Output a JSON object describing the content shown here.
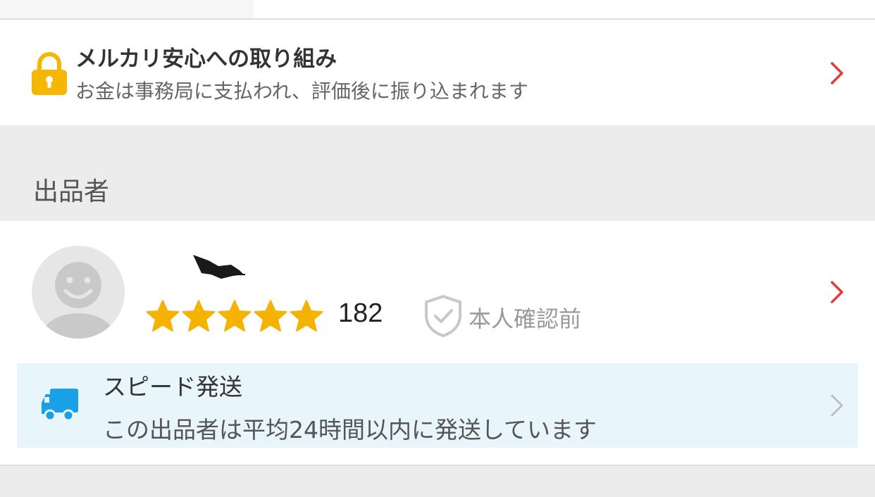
{
  "safety": {
    "title": "メルカリ安心への取り組み",
    "subtitle": "お金は事務局に支払われ、評価後に振り込まれます",
    "icon": "lock-icon",
    "accent": "#f5b700"
  },
  "seller_section": {
    "header": "出品者"
  },
  "seller": {
    "rating_stars": 5,
    "rating_count": "182",
    "verification_label": "本人確認前",
    "star_color": "#f5b300",
    "chevron_color": "#e63b3b"
  },
  "speed_shipping": {
    "title": "スピード発送",
    "description": "この出品者は平均24時間以内に発送しています",
    "icon": "truck-icon",
    "icon_color": "#1aa0e6",
    "background": "#e8f5fb"
  }
}
